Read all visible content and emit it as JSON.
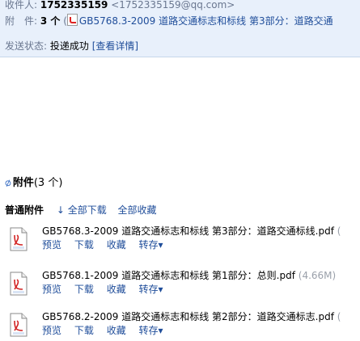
{
  "header": {
    "recipient_label": "收件人:",
    "recipient_name": "1752335159",
    "recipient_email": "<1752335159@qq.com>",
    "attachment_label": "附　件:",
    "attachment_count": "3 个",
    "attachment_first_prefix": "(",
    "attachment_first_name": "GB5768.3-2009 道路交通标志和标线 第3部分：道路交通",
    "send_status_label": "发送状态:",
    "send_status_value": "投递成功",
    "view_detail": "[查看详情]"
  },
  "attachments_section": {
    "title": "附件",
    "count": "(3 个)",
    "tab_normal": "普通附件",
    "download_all": "↓ 全部下载",
    "save_all": "全部收藏",
    "items": [
      {
        "name": "GB5768.3-2009 道路交通标志和标线 第3部分：道路交通标线.pdf",
        "size": "(",
        "actions": [
          "预览",
          "下载",
          "收藏",
          "转存▾"
        ]
      },
      {
        "name": "GB5768.1-2009 道路交通标志和标线 第1部分：总则.pdf",
        "size": "(4.66M)",
        "actions": [
          "预览",
          "下载",
          "收藏",
          "转存▾"
        ]
      },
      {
        "name": "GB5768.2-2009 道路交通标志和标线 第2部分：道路交通标志.pdf",
        "size": "(",
        "actions": [
          "预览",
          "下载",
          "收藏",
          "转存▾"
        ]
      }
    ]
  },
  "colors": {
    "header_bg": "#e8f0fb",
    "link": "#1f4d9a",
    "muted": "#6a7790",
    "pdf_red": "#d22222"
  }
}
